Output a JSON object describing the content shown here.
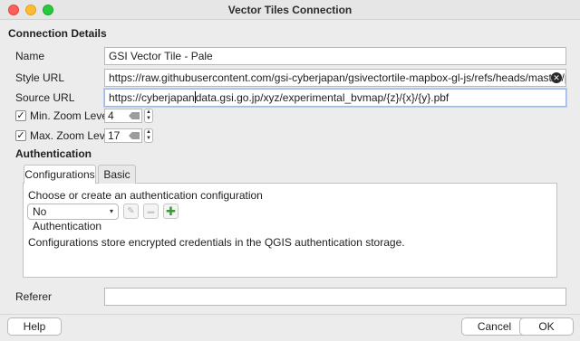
{
  "window": {
    "title": "Vector Tiles Connection"
  },
  "sections": {
    "connection_details": "Connection Details",
    "authentication": "Authentication"
  },
  "fields": {
    "name": {
      "label": "Name",
      "value": "GSI Vector Tile - Pale"
    },
    "style_url": {
      "label": "Style URL",
      "value": "https://raw.githubusercontent.com/gsi-cyberjapan/gsivectortile-mapbox-gl-js/refs/heads/master/pale.json"
    },
    "source_url": {
      "label": "Source URL",
      "value_before_cursor": "https://cyberjapan",
      "value_after_cursor": "data.gsi.go.jp/xyz/experimental_bvmap/{z}/{x}/{y}.pbf"
    },
    "min_zoom": {
      "label": "Min. Zoom Level",
      "checked": true,
      "value": "4"
    },
    "max_zoom": {
      "label": "Max. Zoom Level",
      "checked": true,
      "value": "17"
    },
    "referer": {
      "label": "Referer",
      "value": ""
    }
  },
  "auth": {
    "tabs": [
      {
        "label": "Configurations",
        "active": true
      },
      {
        "label": "Basic",
        "active": false
      }
    ],
    "choose_text": "Choose or create an authentication configuration",
    "selected_config": "No Authentication",
    "info_text": "Configurations store encrypted credentials in the QGIS authentication storage."
  },
  "buttons": {
    "help": "Help",
    "cancel": "Cancel",
    "ok": "OK"
  },
  "symbols": {
    "check": "✓",
    "clear": "✕",
    "arrow_up": "▲",
    "arrow_down": "▼",
    "combo_arrow": "▾",
    "edit": "✎",
    "remove": "▬",
    "add": "✚"
  },
  "colors": {
    "add_icon": "#3a9a3a",
    "close": "#fe5f57",
    "minimize": "#febc2e",
    "maximize": "#28c840"
  }
}
